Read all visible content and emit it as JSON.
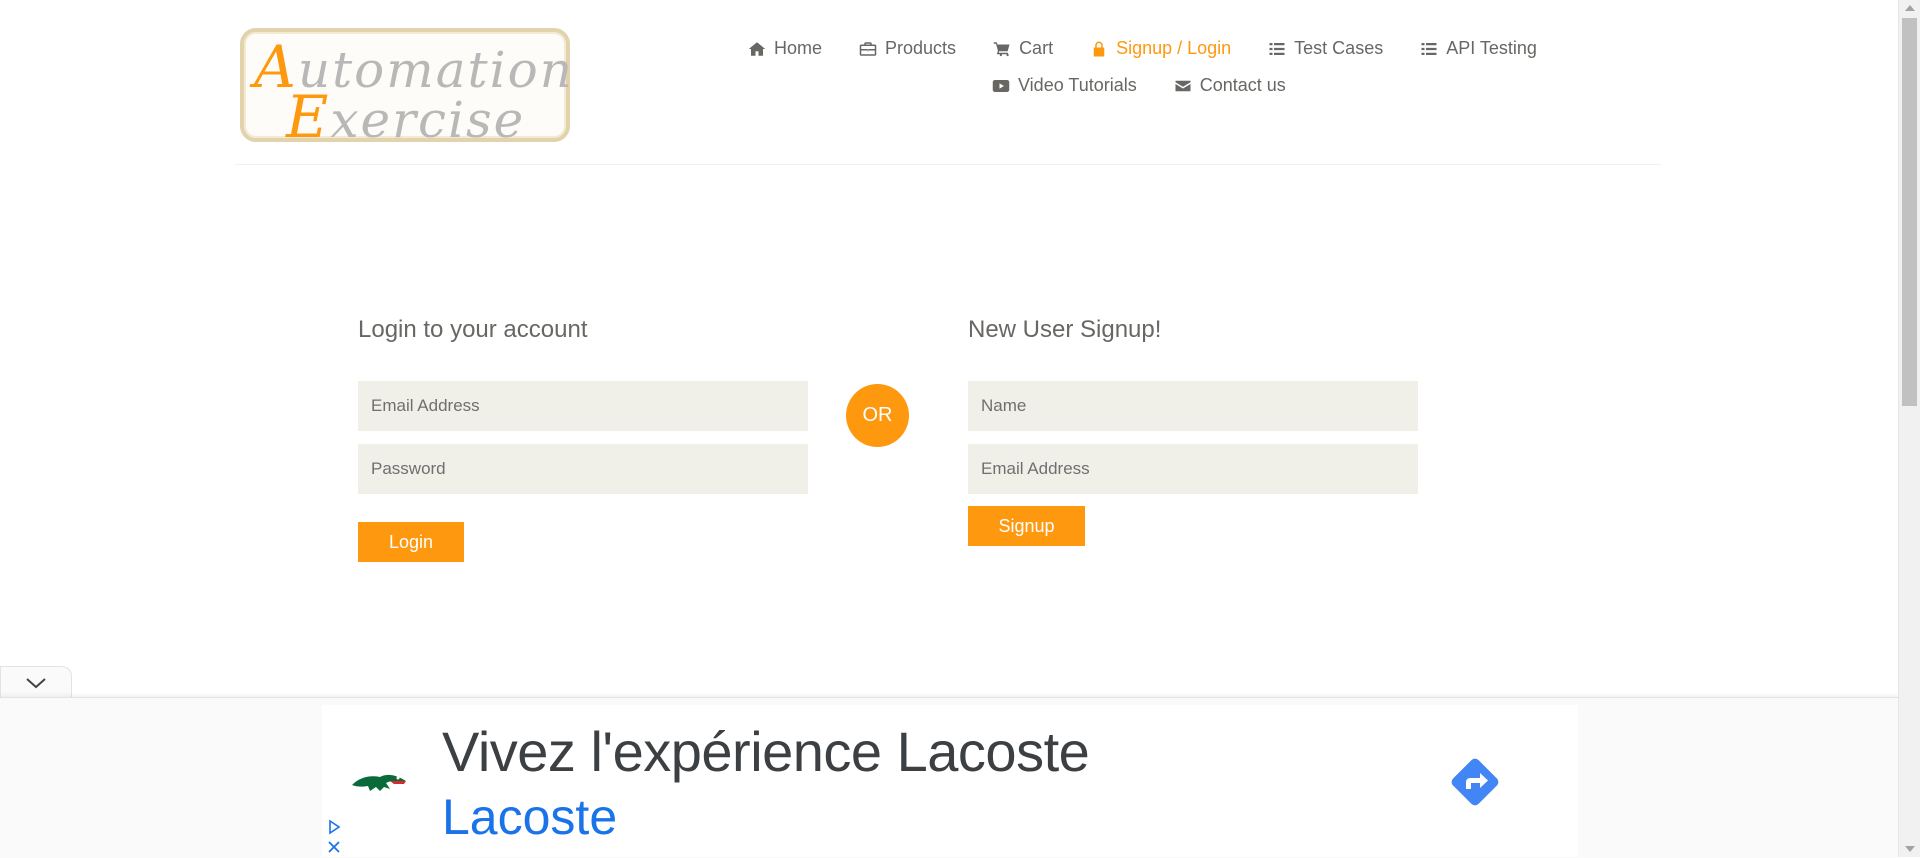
{
  "header": {
    "logo": {
      "line1_first": "A",
      "line1_rest": "utomation",
      "line2_first": "E",
      "line2_rest": "xercise"
    },
    "nav": [
      {
        "label": "Home",
        "icon": "home-icon"
      },
      {
        "label": "Products",
        "icon": "briefcase-icon"
      },
      {
        "label": "Cart",
        "icon": "cart-icon"
      },
      {
        "label": "Signup / Login",
        "icon": "lock-icon",
        "active": true
      },
      {
        "label": "Test Cases",
        "icon": "list-icon"
      },
      {
        "label": "API Testing",
        "icon": "list-icon"
      },
      {
        "label": "Video Tutorials",
        "icon": "youtube-play-icon"
      },
      {
        "label": "Contact us",
        "icon": "envelope-icon"
      }
    ]
  },
  "login": {
    "title": "Login to your account",
    "email_placeholder": "Email Address",
    "email_value": "",
    "password_placeholder": "Password",
    "password_value": "",
    "button_label": "Login"
  },
  "or_label": "OR",
  "signup": {
    "title": "New User Signup!",
    "name_placeholder": "Name",
    "name_value": "",
    "email_placeholder": "Email Address",
    "email_value": "",
    "button_label": "Signup"
  },
  "ad": {
    "headline": "Vivez l'expérience Lacoste",
    "brand": "Lacoste",
    "brand_color": "#1a73e8",
    "logo_icon": "crocodile-logo-icon",
    "action_icon": "directions-arrow-icon"
  },
  "colors": {
    "accent": "#fe980f",
    "text": "#696763",
    "field_bg": "#f0f0e9",
    "ad_arrow": "#4285f4"
  }
}
